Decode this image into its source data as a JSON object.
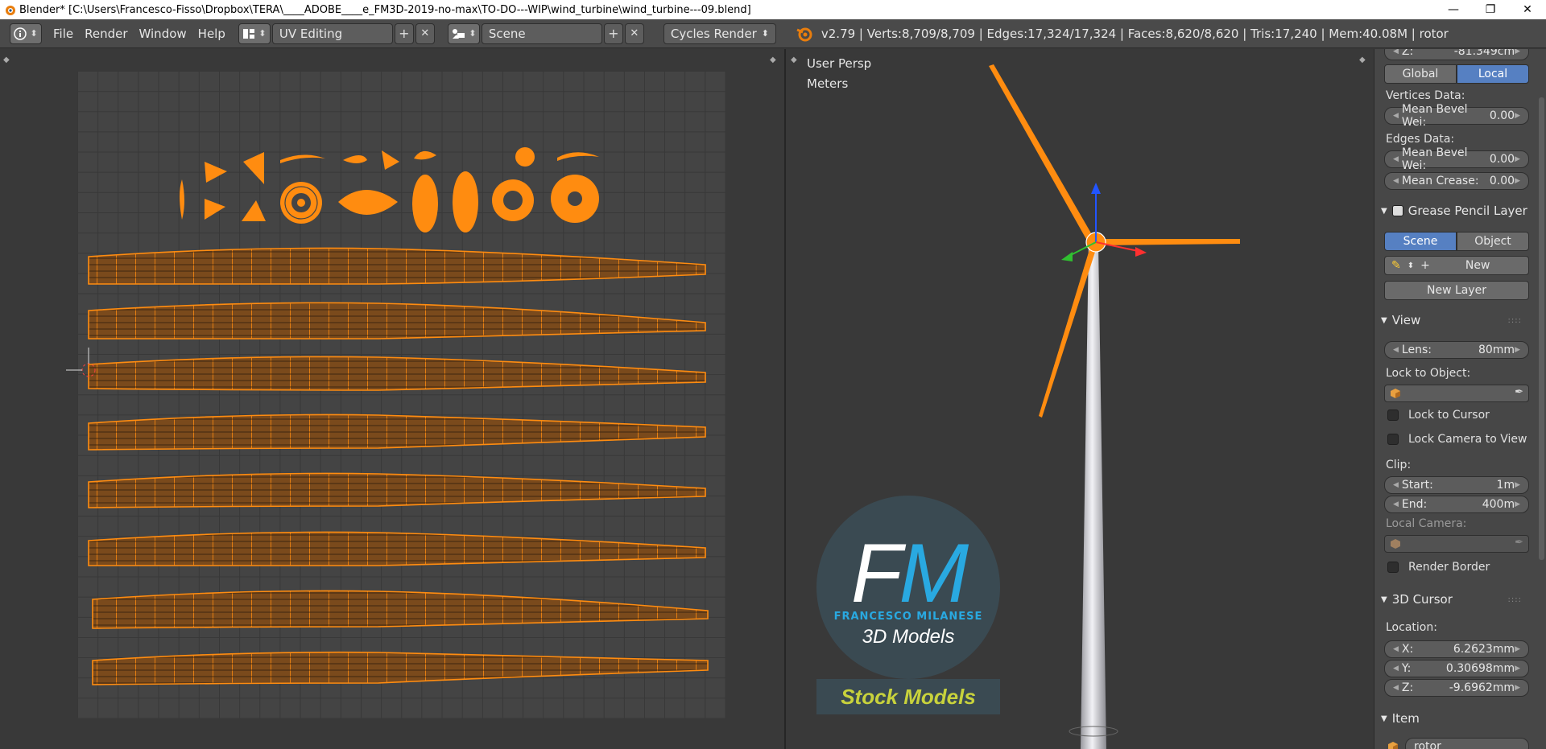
{
  "window": {
    "title": "Blender* [C:\\Users\\Francesco-Fisso\\Dropbox\\TERA\\____ADOBE____e_FM3D-2019-no-max\\TO-DO---WIP\\wind_turbine\\wind_turbine---09.blend]",
    "minimize": "—",
    "maximize": "❐",
    "close": "✕"
  },
  "header": {
    "menus": [
      "File",
      "Render",
      "Window",
      "Help"
    ],
    "screen_layout": "UV Editing",
    "scene": "Scene",
    "render_engine": "Cycles Render",
    "stats": "v2.79 | Verts:8,709/8,709 | Edges:17,324/17,324 | Faces:8,620/8,620 | Tris:17,240 | Mem:40.08M | rotor",
    "add_symbol": "+",
    "remove_symbol": "✕",
    "dropdown_symbol": "⬍"
  },
  "viewport": {
    "view_name": "User Persp",
    "units": "Meters",
    "logo": {
      "letter_f": "F",
      "letter_m": "M",
      "subtitle": "FRANCESCO MILANESE",
      "tagline": "3D Models",
      "banner": "Stock Models"
    }
  },
  "properties": {
    "z_field": {
      "label": "Z:",
      "value": "-81.349cm"
    },
    "space_toggle": {
      "global": "Global",
      "local": "Local",
      "active": "Local"
    },
    "vertices_data": "Vertices Data:",
    "vertex_bevel": {
      "label": "Mean Bevel Wei:",
      "value": "0.00"
    },
    "edges_data": "Edges Data:",
    "edge_bevel": {
      "label": "Mean Bevel Wei:",
      "value": "0.00"
    },
    "mean_crease": {
      "label": "Mean Crease:",
      "value": "0.00"
    },
    "grease_pencil": {
      "title": "Grease Pencil Layer",
      "scene": "Scene",
      "object": "Object",
      "active": "Scene",
      "new": "New",
      "new_layer": "New Layer"
    },
    "view_section": {
      "title": "View",
      "lens": {
        "label": "Lens:",
        "value": "80mm"
      },
      "lock_to_object": "Lock to Object:",
      "lock_to_cursor": "Lock to Cursor",
      "lock_camera": "Lock Camera to View",
      "clip": "Clip:",
      "clip_start": {
        "label": "Start:",
        "value": "1m"
      },
      "clip_end": {
        "label": "End:",
        "value": "400m"
      },
      "local_camera": "Local Camera:",
      "render_border": "Render Border"
    },
    "cursor_section": {
      "title": "3D Cursor",
      "location": "Location:",
      "x": {
        "label": "X:",
        "value": "6.2623mm"
      },
      "y": {
        "label": "Y:",
        "value": "0.30698mm"
      },
      "z": {
        "label": "Z:",
        "value": "-9.6962mm"
      }
    },
    "item_section": {
      "title": "Item",
      "name": "rotor"
    },
    "grip": "::::"
  },
  "colors": {
    "uv_orange": "#ff8c10",
    "active_blue": "#5680c2",
    "logo_blue": "#29a9e1",
    "stock_yellow": "#c8d23c"
  }
}
